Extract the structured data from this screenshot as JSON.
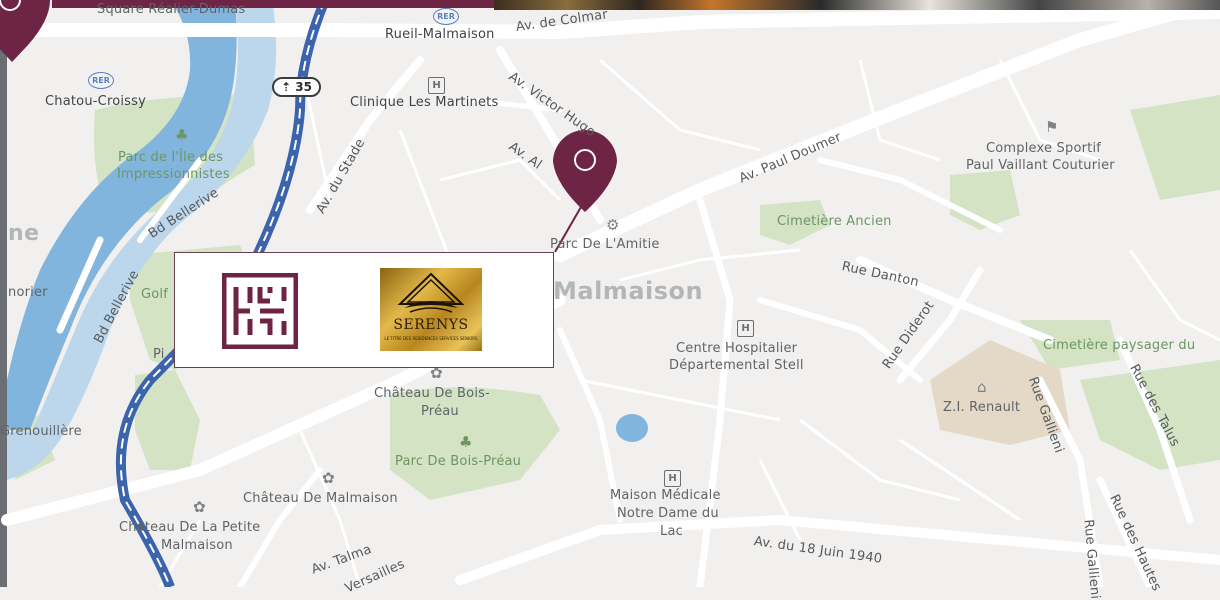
{
  "colors": {
    "marker": "#6e2445",
    "water": "#7fb2dc",
    "rail": "#3b64ad",
    "park": "#cfe0c0",
    "road": "#ffffff",
    "land": "#f1f0ee"
  },
  "labels": {
    "square_realier": "Square Réalier-Dumas",
    "rer_station_1": "RER",
    "rueil_malmaison": "Rueil-Malmaison",
    "av_colmar": "Av. de Colmar",
    "rer_station_2": "RER",
    "chatou_croissy": "Chatou-Croissy",
    "route_shield": "35",
    "clinique": "Clinique Les Martinets",
    "av_victor_hugo": "Av. Victor Hugo",
    "av_al": "Av. Al",
    "av_stade": "Av. du Stade",
    "parc_ile_1": "Parc de l'Île des",
    "parc_ile_2": "Impressionnistes",
    "bd_bellerive_1": "Bd Bellerive",
    "bd_bellerive_2": "Bd Bellerive",
    "av_paul_doumer": "Av. Paul Doumer",
    "complexe_1": "Complexe Sportif",
    "complexe_2": "Paul Vaillant Couturier",
    "cimetiere_ancien": "Cimetière Ancien",
    "parc_amitie": "Parc De L'Amitie",
    "rue_danton": "Rue Danton",
    "malmaison": "Malmaison",
    "rue_diderot": "Rue Diderot",
    "cimetiere_paysager": "Cimetière paysager du",
    "centre_hosp_1": "Centre Hospitalier",
    "centre_hosp_2": "Départemental Stell",
    "rue_gallieni_1": "Rue Gallieni",
    "rue_des_talus": "Rue des Talus",
    "zi_renault": "Z.I. Renault",
    "chateau_bois_preau_1": "Château De Bois-",
    "chateau_bois_preau_2": "Préau",
    "parc_bois_preau": "Parc De Bois-Préau",
    "chateau_malmaison": "Château De Malmaison",
    "chateau_petite_1": "Château De La Petite",
    "chateau_petite_2": "Malmaison",
    "maison_medicale_1": "Maison Médicale",
    "maison_medicale_2": "Notre Dame du",
    "maison_medicale_3": "Lac",
    "av_18_juin": "Av. du 18 Juin 1940",
    "rue_hautes": "Rue des Hautes",
    "rue_gallieni_2": "Rue Gallieni",
    "av_talma": "Av. Talma",
    "versailles": "Versailles",
    "ne": "ne",
    "norier": "norier",
    "golf": "Golf",
    "pi": "Pi",
    "grenouillere": "Grenouillère"
  },
  "logos": {
    "serenys": "SERENYS",
    "serenys_tagline": "LE TITRE DES RESIDENCES SERVICES SENIORS"
  }
}
